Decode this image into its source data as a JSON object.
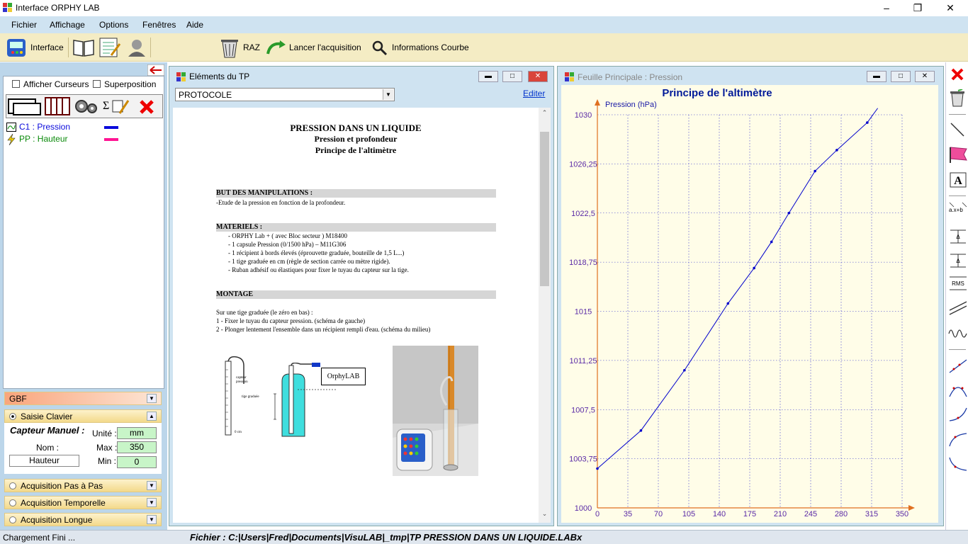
{
  "window": {
    "title": "Interface ORPHY LAB"
  },
  "menu": [
    "Fichier",
    "Affichage",
    "Options",
    "Fenêtres",
    "Aide"
  ],
  "toolbar": {
    "interface": "Interface",
    "raz": "RAZ",
    "lancer": "Lancer l'acquisition",
    "infos": "Informations Courbe"
  },
  "left": {
    "afficher_curseurs": "Afficher Curseurs",
    "superposition": "Superposition",
    "channels": [
      {
        "label": "C1 : Pression",
        "color": "#0a0adc"
      },
      {
        "label": "PP : Hauteur",
        "color": "#ff1493"
      }
    ],
    "gbf": "GBF",
    "saisie": "Saisie Clavier",
    "capteur": "Capteur Manuel :",
    "unite_label": "Unité :",
    "unite": "mm",
    "nom_label": "Nom :",
    "nom": "Hauteur",
    "max_label": "Max :",
    "max": "350",
    "min_label": "Min :",
    "min": "0",
    "pas": "Acquisition Pas à  Pas",
    "temporelle": "Acquisition Temporelle",
    "longue": "Acquisition Longue"
  },
  "tp": {
    "title": "Eléments du TP",
    "select": "PROTOCOLE",
    "edit": "Editer",
    "h1": "PRESSION DANS UN LIQUIDE",
    "h2": "Pression et profondeur",
    "h3": "Principe de l'altimètre",
    "s1": "BUT DES MANIPULATIONS :",
    "s1t": "-Etude de la pression en fonction de la profondeur.",
    "s2": "MATERIELS :",
    "mat": [
      "-  ORPHY Lab + ( avec Bloc secteur ) M18400",
      "-  1 capsule Pression (0/1500 hPa) – M11G306",
      "-  1 récipient à bords élevés (éprouvette graduée, bouteille de 1,5 L...)",
      "-  1 tige graduée en cm (règle de section carrée ou mètre rigide).",
      "-  Ruban adhésif ou élastiques pour fixer le tuyau du capteur sur la tige."
    ],
    "s3": "MONTAGE",
    "mont": [
      "Sur une tige graduée (le zéro en bas) :",
      "1 -  Fixer le tuyau du capteur pression. (schéma de gauche)",
      "2 -  Plonger lentement l'ensemble dans un récipient rempli d'eau. (schéma du milieu)"
    ],
    "fig_orphy": "OrphyLAB",
    "fig_capteur": "capteur pression",
    "fig_tige": "tige graduée",
    "fig_zero": "0 cm"
  },
  "chartwin": {
    "title": "Feuille Principale :  Pression"
  },
  "status": {
    "left": "Chargement Fini ...",
    "file": "Fichier : C:|Users|Fred|Documents|VisuLAB|_tmp|TP PRESSION DANS UN LIQUIDE.LABx"
  },
  "chart_data": {
    "type": "line",
    "title": "Principe de l'altimètre",
    "ylabel": "Pression (hPa)",
    "xlim": [
      0,
      350
    ],
    "ylim": [
      1000,
      1030
    ],
    "xticks": [
      "0",
      "35",
      "70",
      "105",
      "140",
      "175",
      "210",
      "245",
      "280",
      "315",
      "350"
    ],
    "yticks": [
      "1000",
      "1003,75",
      "1007,5",
      "1011,25",
      "1015",
      "1018,75",
      "1022,5",
      "1026,25",
      "1030"
    ],
    "grid": true,
    "color": "#0000cc",
    "series": [
      {
        "x": [
          0,
          50,
          100,
          150,
          180,
          200,
          220,
          250,
          275,
          310,
          322
        ],
        "y": [
          1003,
          1005.9,
          1010.5,
          1015.6,
          1018.3,
          1020.3,
          1022.5,
          1025.7,
          1027.3,
          1029.4,
          1030.5
        ]
      }
    ]
  }
}
